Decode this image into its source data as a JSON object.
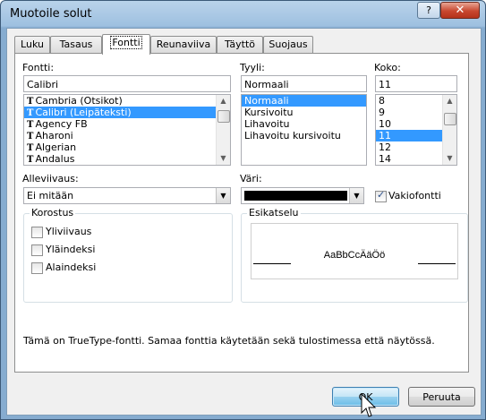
{
  "window": {
    "title": "Muotoile solut",
    "help_label": "?",
    "close_label": "✕"
  },
  "tabs": [
    {
      "label": "Luku",
      "active": false
    },
    {
      "label": "Tasaus",
      "active": false
    },
    {
      "label": "Fontti",
      "active": true
    },
    {
      "label": "Reunaviiva",
      "active": false
    },
    {
      "label": "Täyttö",
      "active": false
    },
    {
      "label": "Suojaus",
      "active": false
    }
  ],
  "font": {
    "label": "Fontti:",
    "value": "Calibri",
    "items": [
      {
        "label": "Cambria (Otsikot)",
        "selected": false
      },
      {
        "label": "Calibri (Leipäteksti)",
        "selected": true
      },
      {
        "label": "Agency FB",
        "selected": false
      },
      {
        "label": "Aharoni",
        "selected": false
      },
      {
        "label": "Algerian",
        "selected": false
      },
      {
        "label": "Andalus",
        "selected": false
      }
    ]
  },
  "style": {
    "label": "Tyyli:",
    "value": "Normaali",
    "items": [
      {
        "label": "Normaali",
        "selected": true
      },
      {
        "label": "Kursivoitu",
        "selected": false
      },
      {
        "label": "Lihavoitu",
        "selected": false
      },
      {
        "label": "Lihavoitu kursivoitu",
        "selected": false
      }
    ]
  },
  "size": {
    "label": "Koko:",
    "value": "11",
    "items": [
      {
        "label": "8",
        "selected": false
      },
      {
        "label": "9",
        "selected": false
      },
      {
        "label": "10",
        "selected": false
      },
      {
        "label": "11",
        "selected": true
      },
      {
        "label": "12",
        "selected": false
      },
      {
        "label": "14",
        "selected": false
      }
    ]
  },
  "underline": {
    "label": "Alleviivaus:",
    "value": "Ei mitään"
  },
  "color": {
    "label": "Väri:",
    "value_color": "#000000",
    "auto_label": "Vakiofontti",
    "auto_checked": true
  },
  "effects": {
    "label": "Korostus",
    "items": [
      {
        "label": "Yliviivaus",
        "checked": false
      },
      {
        "label": "Yläindeksi",
        "checked": false
      },
      {
        "label": "Alaindeksi",
        "checked": false
      }
    ]
  },
  "preview": {
    "label": "Esikatselu",
    "sample": "AaBbCcÄäÖö"
  },
  "note": "Tämä on TrueType-fontti. Samaa fonttia käytetään sekä tulostimessa että näytössä.",
  "buttons": {
    "ok": "OK",
    "cancel": "Peruuta"
  },
  "colors": {
    "selection": "#3399ff",
    "titlebar": "#9ec0e0"
  }
}
